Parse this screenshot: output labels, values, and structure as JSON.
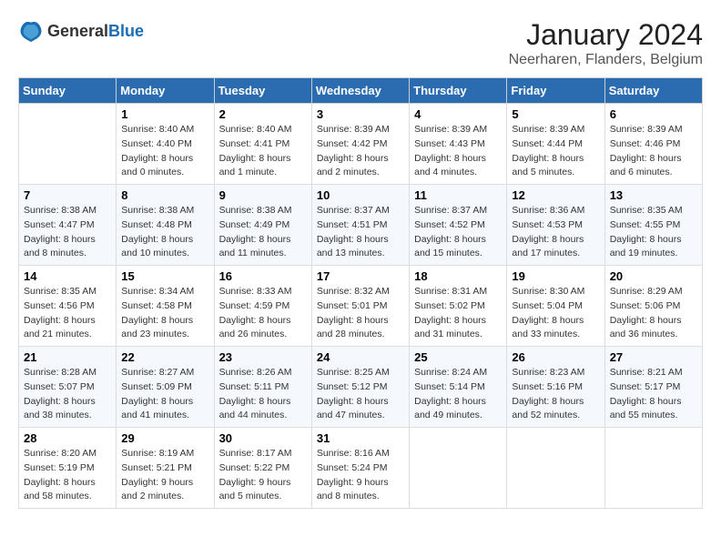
{
  "logo": {
    "general": "General",
    "blue": "Blue"
  },
  "title": "January 2024",
  "subtitle": "Neerharen, Flanders, Belgium",
  "days_header": [
    "Sunday",
    "Monday",
    "Tuesday",
    "Wednesday",
    "Thursday",
    "Friday",
    "Saturday"
  ],
  "weeks": [
    [
      {
        "day": "",
        "sunrise": "",
        "sunset": "",
        "daylight": ""
      },
      {
        "day": "1",
        "sunrise": "Sunrise: 8:40 AM",
        "sunset": "Sunset: 4:40 PM",
        "daylight": "Daylight: 8 hours and 0 minutes."
      },
      {
        "day": "2",
        "sunrise": "Sunrise: 8:40 AM",
        "sunset": "Sunset: 4:41 PM",
        "daylight": "Daylight: 8 hours and 1 minute."
      },
      {
        "day": "3",
        "sunrise": "Sunrise: 8:39 AM",
        "sunset": "Sunset: 4:42 PM",
        "daylight": "Daylight: 8 hours and 2 minutes."
      },
      {
        "day": "4",
        "sunrise": "Sunrise: 8:39 AM",
        "sunset": "Sunset: 4:43 PM",
        "daylight": "Daylight: 8 hours and 4 minutes."
      },
      {
        "day": "5",
        "sunrise": "Sunrise: 8:39 AM",
        "sunset": "Sunset: 4:44 PM",
        "daylight": "Daylight: 8 hours and 5 minutes."
      },
      {
        "day": "6",
        "sunrise": "Sunrise: 8:39 AM",
        "sunset": "Sunset: 4:46 PM",
        "daylight": "Daylight: 8 hours and 6 minutes."
      }
    ],
    [
      {
        "day": "7",
        "sunrise": "Sunrise: 8:38 AM",
        "sunset": "Sunset: 4:47 PM",
        "daylight": "Daylight: 8 hours and 8 minutes."
      },
      {
        "day": "8",
        "sunrise": "Sunrise: 8:38 AM",
        "sunset": "Sunset: 4:48 PM",
        "daylight": "Daylight: 8 hours and 10 minutes."
      },
      {
        "day": "9",
        "sunrise": "Sunrise: 8:38 AM",
        "sunset": "Sunset: 4:49 PM",
        "daylight": "Daylight: 8 hours and 11 minutes."
      },
      {
        "day": "10",
        "sunrise": "Sunrise: 8:37 AM",
        "sunset": "Sunset: 4:51 PM",
        "daylight": "Daylight: 8 hours and 13 minutes."
      },
      {
        "day": "11",
        "sunrise": "Sunrise: 8:37 AM",
        "sunset": "Sunset: 4:52 PM",
        "daylight": "Daylight: 8 hours and 15 minutes."
      },
      {
        "day": "12",
        "sunrise": "Sunrise: 8:36 AM",
        "sunset": "Sunset: 4:53 PM",
        "daylight": "Daylight: 8 hours and 17 minutes."
      },
      {
        "day": "13",
        "sunrise": "Sunrise: 8:35 AM",
        "sunset": "Sunset: 4:55 PM",
        "daylight": "Daylight: 8 hours and 19 minutes."
      }
    ],
    [
      {
        "day": "14",
        "sunrise": "Sunrise: 8:35 AM",
        "sunset": "Sunset: 4:56 PM",
        "daylight": "Daylight: 8 hours and 21 minutes."
      },
      {
        "day": "15",
        "sunrise": "Sunrise: 8:34 AM",
        "sunset": "Sunset: 4:58 PM",
        "daylight": "Daylight: 8 hours and 23 minutes."
      },
      {
        "day": "16",
        "sunrise": "Sunrise: 8:33 AM",
        "sunset": "Sunset: 4:59 PM",
        "daylight": "Daylight: 8 hours and 26 minutes."
      },
      {
        "day": "17",
        "sunrise": "Sunrise: 8:32 AM",
        "sunset": "Sunset: 5:01 PM",
        "daylight": "Daylight: 8 hours and 28 minutes."
      },
      {
        "day": "18",
        "sunrise": "Sunrise: 8:31 AM",
        "sunset": "Sunset: 5:02 PM",
        "daylight": "Daylight: 8 hours and 31 minutes."
      },
      {
        "day": "19",
        "sunrise": "Sunrise: 8:30 AM",
        "sunset": "Sunset: 5:04 PM",
        "daylight": "Daylight: 8 hours and 33 minutes."
      },
      {
        "day": "20",
        "sunrise": "Sunrise: 8:29 AM",
        "sunset": "Sunset: 5:06 PM",
        "daylight": "Daylight: 8 hours and 36 minutes."
      }
    ],
    [
      {
        "day": "21",
        "sunrise": "Sunrise: 8:28 AM",
        "sunset": "Sunset: 5:07 PM",
        "daylight": "Daylight: 8 hours and 38 minutes."
      },
      {
        "day": "22",
        "sunrise": "Sunrise: 8:27 AM",
        "sunset": "Sunset: 5:09 PM",
        "daylight": "Daylight: 8 hours and 41 minutes."
      },
      {
        "day": "23",
        "sunrise": "Sunrise: 8:26 AM",
        "sunset": "Sunset: 5:11 PM",
        "daylight": "Daylight: 8 hours and 44 minutes."
      },
      {
        "day": "24",
        "sunrise": "Sunrise: 8:25 AM",
        "sunset": "Sunset: 5:12 PM",
        "daylight": "Daylight: 8 hours and 47 minutes."
      },
      {
        "day": "25",
        "sunrise": "Sunrise: 8:24 AM",
        "sunset": "Sunset: 5:14 PM",
        "daylight": "Daylight: 8 hours and 49 minutes."
      },
      {
        "day": "26",
        "sunrise": "Sunrise: 8:23 AM",
        "sunset": "Sunset: 5:16 PM",
        "daylight": "Daylight: 8 hours and 52 minutes."
      },
      {
        "day": "27",
        "sunrise": "Sunrise: 8:21 AM",
        "sunset": "Sunset: 5:17 PM",
        "daylight": "Daylight: 8 hours and 55 minutes."
      }
    ],
    [
      {
        "day": "28",
        "sunrise": "Sunrise: 8:20 AM",
        "sunset": "Sunset: 5:19 PM",
        "daylight": "Daylight: 8 hours and 58 minutes."
      },
      {
        "day": "29",
        "sunrise": "Sunrise: 8:19 AM",
        "sunset": "Sunset: 5:21 PM",
        "daylight": "Daylight: 9 hours and 2 minutes."
      },
      {
        "day": "30",
        "sunrise": "Sunrise: 8:17 AM",
        "sunset": "Sunset: 5:22 PM",
        "daylight": "Daylight: 9 hours and 5 minutes."
      },
      {
        "day": "31",
        "sunrise": "Sunrise: 8:16 AM",
        "sunset": "Sunset: 5:24 PM",
        "daylight": "Daylight: 9 hours and 8 minutes."
      },
      {
        "day": "",
        "sunrise": "",
        "sunset": "",
        "daylight": ""
      },
      {
        "day": "",
        "sunrise": "",
        "sunset": "",
        "daylight": ""
      },
      {
        "day": "",
        "sunrise": "",
        "sunset": "",
        "daylight": ""
      }
    ]
  ]
}
